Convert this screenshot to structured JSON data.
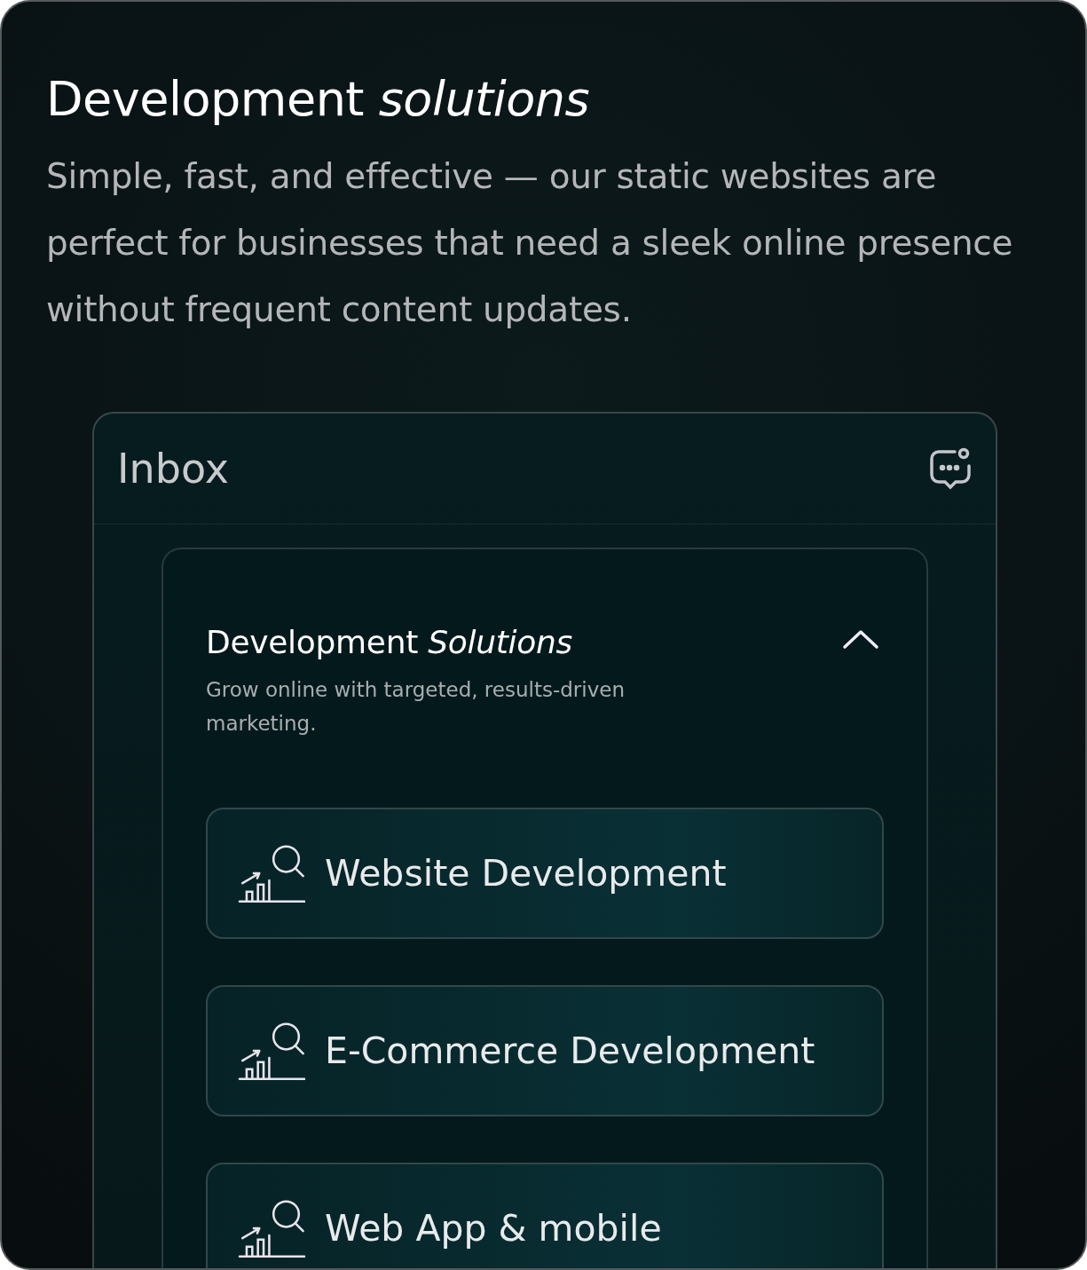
{
  "section": {
    "title": "Development *solutions*",
    "description": "Simple, fast, and effective — our static websites are perfect for businesses that need a sleek online presence without frequent content updates."
  },
  "inbox": {
    "title": "Inbox",
    "accordion": {
      "title": "Development *Solutions*",
      "subtitle": "Grow online with targeted, results-driven marketing.",
      "expanded": true,
      "items": [
        {
          "label": "Website Development"
        },
        {
          "label": "E-Commerce Development"
        },
        {
          "label": "Web App & mobile"
        }
      ]
    }
  }
}
